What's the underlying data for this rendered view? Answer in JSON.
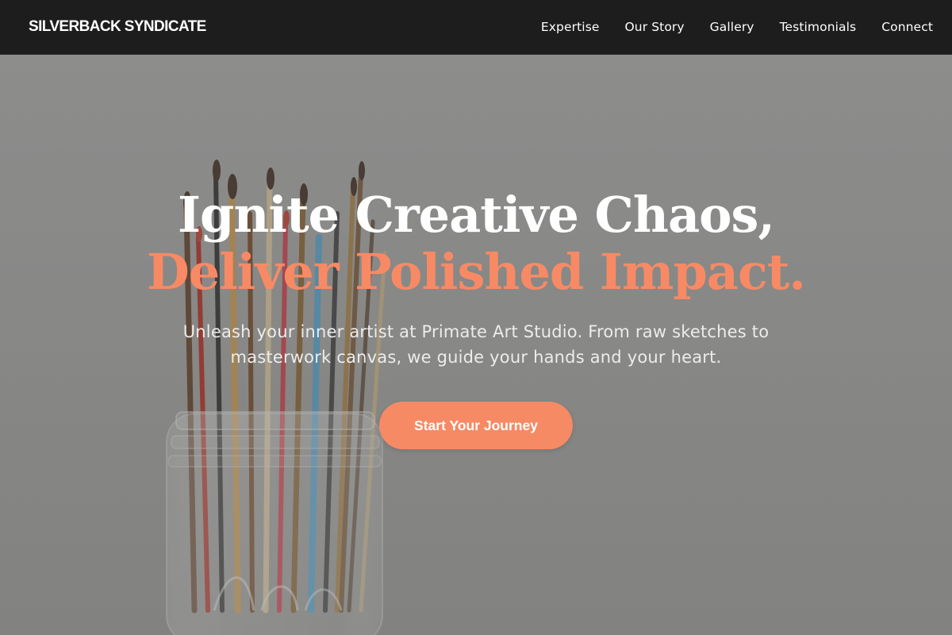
{
  "brand": {
    "name": "SILVERBACK SYNDICATE"
  },
  "nav": {
    "items": [
      {
        "label": "Expertise"
      },
      {
        "label": "Our Story"
      },
      {
        "label": "Gallery"
      },
      {
        "label": "Testimonials"
      },
      {
        "label": "Connect"
      }
    ]
  },
  "hero": {
    "title_line1": "Ignite Creative Chaos,",
    "title_line2": "Deliver Polished Impact.",
    "subtitle": "Unleash your inner artist at Primate Art Studio. From raw sketches to masterwork canvas, we guide your hands and your heart.",
    "cta_label": "Start Your Journey",
    "background_image": "paintbrushes-in-glass-jar"
  },
  "colors": {
    "navbar_bg": "#1d1d1d",
    "accent": "#f68a64",
    "text_light": "#ffffff"
  }
}
